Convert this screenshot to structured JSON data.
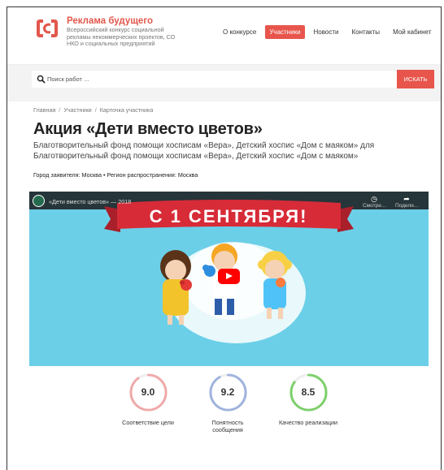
{
  "brand": {
    "title": "Реклама будущего",
    "subtitle": "Всероссийский конкурс социальной рекламы некоммерческих проектов, СО НКО и социальных предприятий",
    "logo_color": "#e2574c"
  },
  "nav": {
    "items": [
      {
        "label": "О конкурсе",
        "active": false
      },
      {
        "label": "Участники",
        "active": true
      },
      {
        "label": "Новости",
        "active": false
      },
      {
        "label": "Контакты",
        "active": false
      },
      {
        "label": "Мой кабинет",
        "active": false
      }
    ]
  },
  "search": {
    "placeholder": "Поиск работ ...",
    "button_label": "ИСКАТЬ",
    "icon": "search-icon"
  },
  "breadcrumb": [
    "Главная",
    "Участники",
    "Карточка участника"
  ],
  "page": {
    "title": "Акция «Дети вместо цветов»",
    "subtitle": "Благотворительный фонд помощи хосписам «Вера», Детский хоспис «Дом с маяком» для Благотворительный фонд помощи хосписам «Вера», Детский хоспис «Дом с маяком»",
    "meta": "Город заявителя: Москва • Регион распространения: Москва"
  },
  "video": {
    "title": "«Дети вместо цветов» — 2018",
    "banner_text": "С 1 СЕНТЯБРЯ!",
    "watch_later_label": "Смотре...",
    "share_label": "Подели...",
    "background_color": "#6ccfe8",
    "banner_color": "#d72b38"
  },
  "scores": [
    {
      "value": "9.0",
      "label": "Соответствие цели",
      "color": "#f0a9a9",
      "fill": 0.9
    },
    {
      "value": "9.2",
      "label": "Понятность сообщения",
      "color": "#9fb3dd",
      "fill": 0.92
    },
    {
      "value": "8.5",
      "label": "Качество реализации",
      "color": "#7dcf6a",
      "fill": 0.85
    }
  ],
  "accent_color": "#e8554c"
}
